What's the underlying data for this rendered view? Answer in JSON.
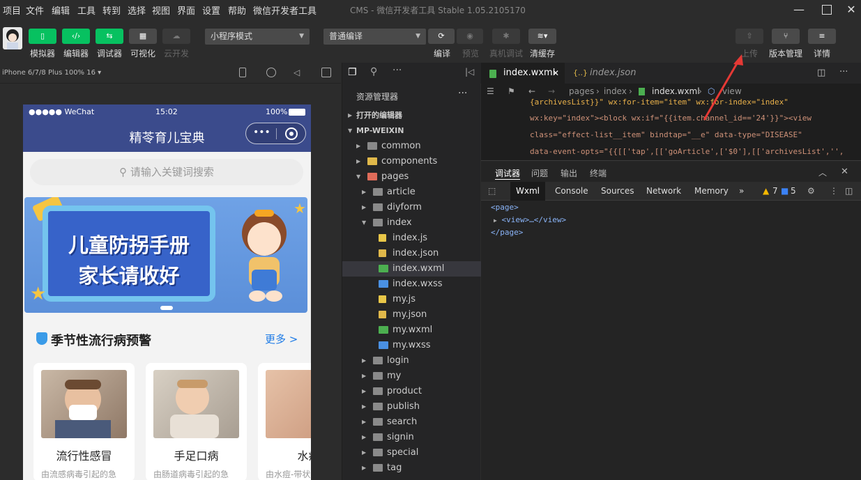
{
  "menu": [
    "项目",
    "文件",
    "编辑",
    "工具",
    "转到",
    "选择",
    "视图",
    "界面",
    "设置",
    "帮助",
    "微信开发者工具"
  ],
  "window_title": "CMS - 微信开发者工具 Stable 1.05.2105170",
  "toolbar": {
    "modes": [
      "模拟器",
      "编辑器",
      "调试器",
      "可视化",
      "云开发"
    ],
    "mode_select": "小程序模式",
    "compile_select": "普通编译",
    "actions": [
      "编译",
      "预览",
      "真机调试",
      "清缓存"
    ],
    "right": [
      "上传",
      "版本管理",
      "详情"
    ]
  },
  "simulator": {
    "device": "iPhone 6/7/8 Plus 100% 16 ▾"
  },
  "phone": {
    "status_left": "●●●●● WeChat",
    "status_time": "15:02",
    "status_battery": "100%",
    "nav_title": "精苓育儿宝典",
    "search_placeholder": "请输入关键词搜索",
    "banner_line1": "儿童防拐手册",
    "banner_line2": "家长请收好",
    "section_title": "季节性流行病预警",
    "more": "更多 >",
    "cards": [
      {
        "name": "流行性感冒",
        "desc": "由流感病毒引起的急"
      },
      {
        "name": "手足口病",
        "desc": "由肠道病毒引起的急"
      },
      {
        "name": "水痘",
        "desc": "由水痘-带状"
      }
    ]
  },
  "explorer": {
    "title": "资源管理器",
    "open_editors": "打开的编辑器",
    "root": "MP-WEIXIN",
    "items": [
      {
        "label": "common",
        "depth": 1,
        "type": "folder",
        "arrow": "▶"
      },
      {
        "label": "components",
        "depth": 1,
        "type": "folder-yellow",
        "arrow": "▶"
      },
      {
        "label": "pages",
        "depth": 1,
        "type": "folder-red",
        "arrow": "▼"
      },
      {
        "label": "article",
        "depth": 2,
        "type": "folder",
        "arrow": "▶"
      },
      {
        "label": "diyform",
        "depth": 2,
        "type": "folder",
        "arrow": "▶"
      },
      {
        "label": "index",
        "depth": 2,
        "type": "folder",
        "arrow": "▼"
      },
      {
        "label": "index.js",
        "depth": 3,
        "type": "js",
        "arrow": ""
      },
      {
        "label": "index.json",
        "depth": 3,
        "type": "json",
        "arrow": ""
      },
      {
        "label": "index.wxml",
        "depth": 3,
        "type": "wxml",
        "arrow": "",
        "selected": true
      },
      {
        "label": "index.wxss",
        "depth": 3,
        "type": "wxss",
        "arrow": ""
      },
      {
        "label": "my.js",
        "depth": 3,
        "type": "js",
        "arrow": ""
      },
      {
        "label": "my.json",
        "depth": 3,
        "type": "json",
        "arrow": ""
      },
      {
        "label": "my.wxml",
        "depth": 3,
        "type": "wxml",
        "arrow": ""
      },
      {
        "label": "my.wxss",
        "depth": 3,
        "type": "wxss",
        "arrow": ""
      },
      {
        "label": "login",
        "depth": 2,
        "type": "folder",
        "arrow": "▶"
      },
      {
        "label": "my",
        "depth": 2,
        "type": "folder",
        "arrow": "▶"
      },
      {
        "label": "product",
        "depth": 2,
        "type": "folder",
        "arrow": "▶"
      },
      {
        "label": "publish",
        "depth": 2,
        "type": "folder",
        "arrow": "▶"
      },
      {
        "label": "search",
        "depth": 2,
        "type": "folder",
        "arrow": "▶"
      },
      {
        "label": "signin",
        "depth": 2,
        "type": "folder",
        "arrow": "▶"
      },
      {
        "label": "special",
        "depth": 2,
        "type": "folder",
        "arrow": "▶"
      },
      {
        "label": "tag",
        "depth": 2,
        "type": "folder",
        "arrow": "▶"
      }
    ]
  },
  "editor": {
    "tab1": "index.wxml",
    "tab2": "index.json",
    "crumbs": [
      "pages",
      "index",
      "index.wxml",
      "view"
    ],
    "code": [
      "{archivesList}}\" wx:for-item=\"item\" wx:for-index=\"index\"",
      "wx:key=\"index\"><block wx:if=\"{{item.channel_id=='24'}}\"><view",
      "class=\"effect-list__item\" bindtap=\"__e\" data-type=\"DISEASE\"",
      "data-event-opts=\"{{[['tap',[['goArticle',['$0'],[['archivesList','',"
    ]
  },
  "devtools": {
    "top_tabs": [
      "调试器",
      "问题",
      "输出",
      "终端"
    ],
    "tabs": [
      "Wxml",
      "Console",
      "Sources",
      "Network",
      "Memory"
    ],
    "more": "»",
    "warnings": "7",
    "errors": "5",
    "xml": [
      "<page>",
      "<view>…</view>",
      "</page>"
    ]
  }
}
